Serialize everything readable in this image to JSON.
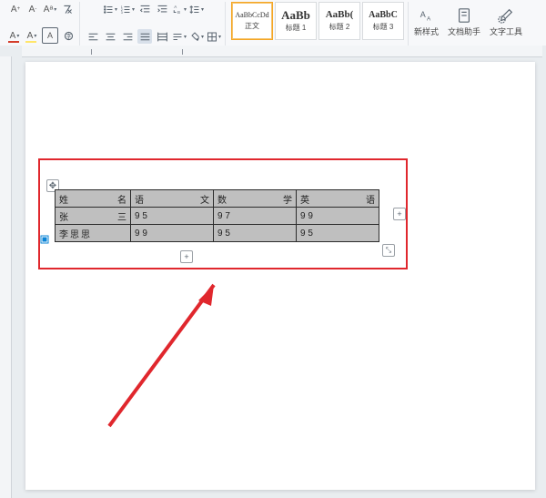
{
  "ribbon": {
    "styles": [
      {
        "preview": "AaBbCcDd",
        "label": "正文"
      },
      {
        "preview": "AaBb",
        "label": "标题 1"
      },
      {
        "preview": "AaBb(",
        "label": "标题 2"
      },
      {
        "preview": "AaBbC",
        "label": "标题 3"
      }
    ],
    "new_style": "新样式",
    "doc_assist": "文档助手",
    "text_tools": "文字工具"
  },
  "table": {
    "headers": [
      "姓名",
      "语文",
      "数学",
      "英语"
    ],
    "rows": [
      {
        "name": "张三",
        "values": [
          "9    5",
          "9    7",
          "9    9"
        ]
      },
      {
        "name": "李思思",
        "values": [
          "9    9",
          "9    5",
          "9    5"
        ]
      }
    ]
  },
  "handles": {
    "plus": "+",
    "move": "⤡"
  }
}
